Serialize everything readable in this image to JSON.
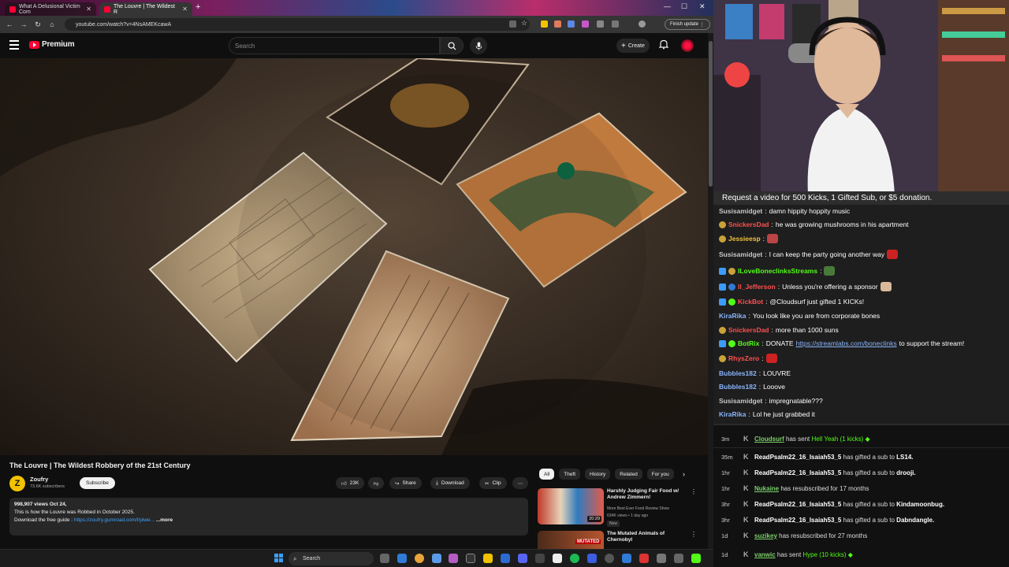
{
  "browser": {
    "tabs": [
      {
        "label": "What A Delusional Victim Com"
      },
      {
        "label": "The Louvre | The Wildest R"
      }
    ],
    "url": "youtube.com/watch?v=4NsAMEKcawA",
    "finish_update": "Finish update"
  },
  "youtube": {
    "brand": "Premium",
    "search_placeholder": "Search",
    "create_label": "Create",
    "video_title": "The Louvre | The Wildest Robbery of the 21st Century",
    "channel": {
      "name": "Zoufry",
      "avatar_letter": "Z",
      "subscribers": "73.6K subscribers"
    },
    "subscribe_label": "Subscribe",
    "actions": {
      "likes": "23K",
      "share": "Share",
      "download": "Download",
      "clip": "Clip"
    },
    "description": {
      "stats": "998,907 views  Oct 24,",
      "line1": "This is how the Louvre was Robbed in October 2025.",
      "line2_prefix": "Download the free guide : ",
      "line2_link": "https://zoufry.gumroad.com/l/piwe...",
      "more": "...more"
    },
    "chips": [
      "All",
      "Theft",
      "History",
      "Related",
      "For you"
    ],
    "recommendations": [
      {
        "title": "Harshly Judging Fair Food w/ Andrew Zimmern!",
        "channel": "More Best Ever Food Review Show",
        "meta": "634K views • 1 day ago",
        "badge": "New",
        "duration": "20:29"
      },
      {
        "title": "The Mutated Animals of Chernobyl",
        "thumb_label": "MUTATED"
      }
    ]
  },
  "taskbar": {
    "search_label": "Search"
  },
  "stream": {
    "banner": "Request a video for 500 Kicks, 1 Gifted Sub, or $5 donation.",
    "chat": [
      {
        "user": "Susisamidget",
        "text": "damn hippity hoppity music",
        "color": "#c7c7c7"
      },
      {
        "user": "SnickersDad",
        "text": "he was growing mushrooms in his apartment",
        "color": "#ff4f4f"
      },
      {
        "user": "Jessieesp",
        "text": "",
        "color": "#f0c33c"
      },
      {
        "user": "Susisamidget",
        "text": "I can keep the party going another way",
        "color": "#c7c7c7"
      },
      {
        "user": "ILoveBoneclinksStreams",
        "text": "",
        "color": "#53fc18"
      },
      {
        "user": "ll_Jefferson",
        "text": "Unless you're offering a sponsor",
        "color": "#ff4f4f"
      },
      {
        "user": "KickBot",
        "text": "@Cloudsurf just gifted 1 KICKs!",
        "color": "#ff4f4f"
      },
      {
        "user": "KiraRika",
        "text": "You look like you are from corporate bones",
        "color": "#8ab4f8"
      },
      {
        "user": "SnickersDad",
        "text": "more than 1000 suns",
        "color": "#ff4f4f"
      },
      {
        "user": "BotRix",
        "text": "DONATE ",
        "link": "https://streamlabs.com/boneclinks",
        "tail": " to support the stream!",
        "color": "#53fc18"
      },
      {
        "user": "RhysZero",
        "text": "",
        "color": "#ff4f4f"
      },
      {
        "user": "Bubbles182",
        "text": "LOUVRE",
        "color": "#8ab4f8"
      },
      {
        "user": "Bubbles182",
        "text": "Looove",
        "color": "#8ab4f8"
      },
      {
        "user": "Susisamidget",
        "text": "impregnatable???",
        "color": "#c7c7c7"
      },
      {
        "user": "KiraRika",
        "text": "Lol he just grabbed it",
        "color": "#8ab4f8"
      }
    ],
    "events": [
      {
        "time": "3m",
        "name": "Cloudsurf",
        "action": "has sent",
        "highlight": "Hell Yeah (1 kicks)"
      },
      {
        "time": "35m",
        "name": "ReadPsalm22_16_Isaiah53_5",
        "action": "has gifted a sub to",
        "target": "LS14."
      },
      {
        "time": "1hr",
        "name": "ReadPsalm22_16_Isaiah53_5",
        "action": "has gifted a sub to",
        "target": "drooji."
      },
      {
        "time": "1hr",
        "name": "Nukaine",
        "action": "has resubscribed for 17 months"
      },
      {
        "time": "3hr",
        "name": "ReadPsalm22_16_Isaiah53_5",
        "action": "has gifted a sub to",
        "target": "Kindamoonbug."
      },
      {
        "time": "3hr",
        "name": "ReadPsalm22_16_Isaiah53_5",
        "action": "has gifted a sub to",
        "target": "Dabndangle."
      },
      {
        "time": "1d",
        "name": "suzikey",
        "action": "has resubscribed for 27 months"
      },
      {
        "time": "1d",
        "name": "vanwic",
        "action": "has sent",
        "highlight": "Hype (10 kicks)"
      }
    ]
  }
}
